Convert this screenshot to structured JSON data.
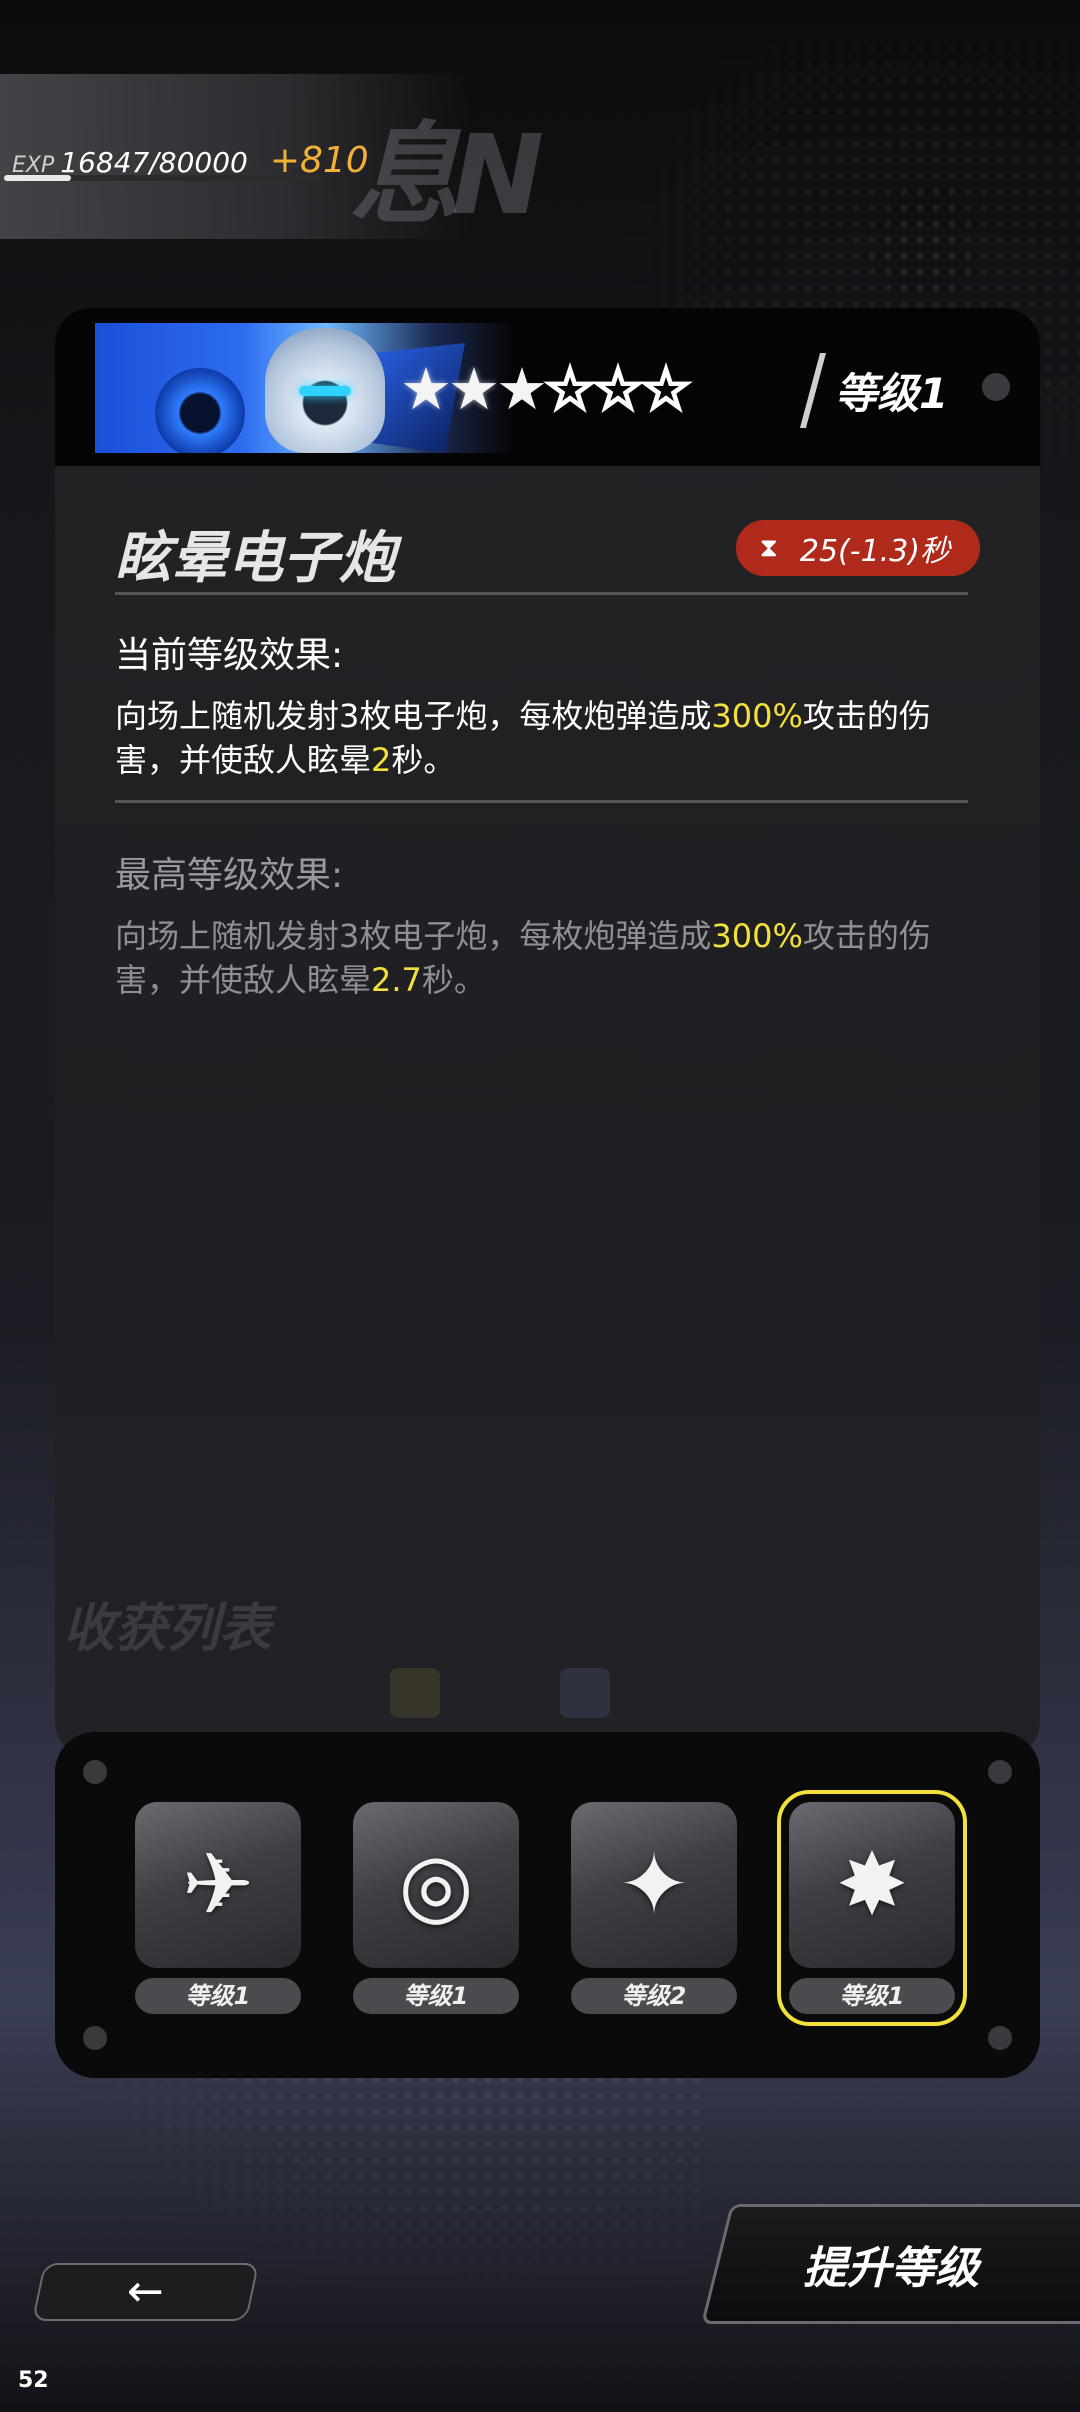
{
  "exp": {
    "label": "EXP",
    "value": "16847/80000",
    "gain": "+810",
    "progress_fraction": 0.21
  },
  "skill": {
    "level_label": "等级1",
    "stars": [
      "full",
      "full",
      "half",
      "empty",
      "empty",
      "empty"
    ],
    "name": "眩晕电子炮",
    "cooldown": "25(-1.3)秒",
    "current": {
      "title": "当前等级效果:",
      "desc_parts": [
        "向场上随机发射3枚电子炮，每枚炮弹造成",
        "300%",
        "攻击的伤害，并使敌人眩晕",
        "2",
        "秒。"
      ]
    },
    "max": {
      "title": "最高等级效果:",
      "desc_parts": [
        "向场上随机发射3枚电子炮，每枚炮弹造成",
        "300%",
        "攻击的伤害，并使敌人眩晕",
        "2.7",
        "秒。"
      ]
    }
  },
  "tray": {
    "slots": [
      {
        "icon": "rocket-burst-icon",
        "glyph": "✈",
        "level": "等级1"
      },
      {
        "icon": "sonic-wave-icon",
        "glyph": "◎",
        "level": "等级1"
      },
      {
        "icon": "orbit-star-icon",
        "glyph": "✦",
        "level": "等级2"
      },
      {
        "icon": "explosion-icon",
        "glyph": "✸",
        "level": "等级1",
        "selected": true
      }
    ]
  },
  "buttons": {
    "upgrade_label": "提升等级",
    "back_icon": "arrow-left-icon"
  },
  "corner_number": "52",
  "colors": {
    "highlight": "#f3e03a",
    "exp_gain": "#f2b135",
    "cooldown_bg": "#b02a1c"
  }
}
